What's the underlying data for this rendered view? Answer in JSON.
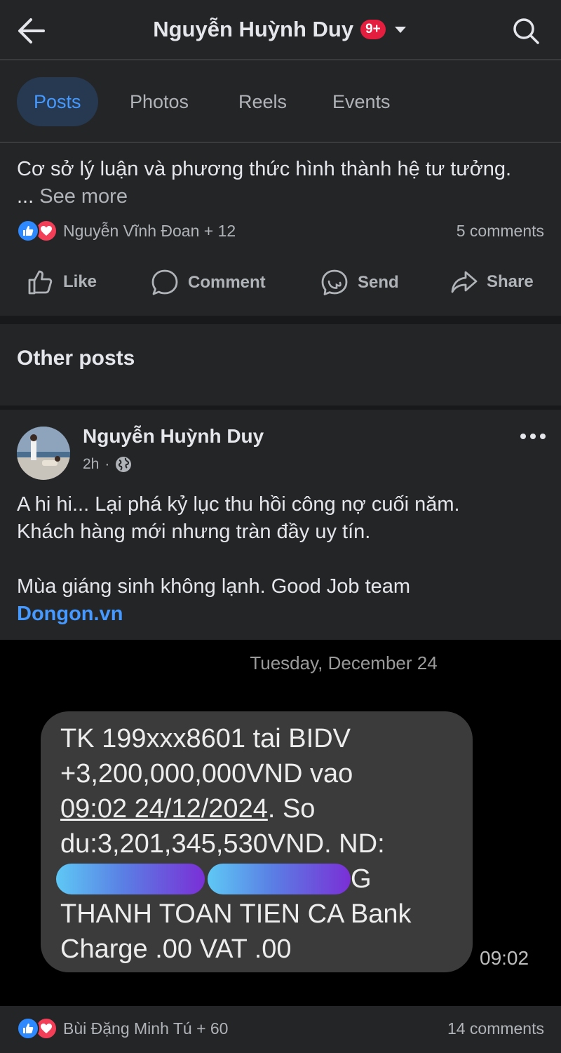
{
  "header": {
    "title": "Nguyễn Huỳnh Duy",
    "badge": "9+"
  },
  "tabs": [
    {
      "label": "Posts",
      "active": true
    },
    {
      "label": "Photos",
      "active": false
    },
    {
      "label": "Reels",
      "active": false
    },
    {
      "label": "Events",
      "active": false
    }
  ],
  "post1": {
    "text": "Cơ sở lý luận và phương thức hình thành hệ tư tưởng.",
    "see_more_prefix": "... ",
    "see_more": "See more",
    "reactions": "Nguyễn Vĩnh Đoan + 12",
    "comments": "5 comments",
    "actions": {
      "like": "Like",
      "comment": "Comment",
      "send": "Send",
      "share": "Share"
    }
  },
  "section_title": "Other posts",
  "post2": {
    "author": "Nguyễn Huỳnh Duy",
    "time": "2h",
    "separator": "·",
    "line1": "A hi hi... Lại phá kỷ lục thu hồi công nợ cuối năm.",
    "line2": "Khách hàng mới nhưng tràn đầy uy tín.",
    "line3": "Mùa giáng sinh không lạnh. Good Job team",
    "link": "Dongon.vn",
    "image": {
      "date": "Tuesday, December 24",
      "sms_line1": "TK 199xxx8601 tai BIDV",
      "sms_line2": "+3,200,000,000VND vao",
      "sms_line3_underlined": "09:02 24/12/2024",
      "sms_line3_rest": ". So",
      "sms_line4": "du:3,201,345,530VND. ND:",
      "sms_redacted_tail": "G",
      "sms_line6": "THANH TOAN TIEN CA Bank",
      "sms_line7": "Charge .00 VAT .00",
      "time": "09:02"
    },
    "reactions": "Bùi Đặng Minh Tú + 60",
    "comments": "14 comments"
  },
  "colors": {
    "background": "#242526",
    "accent_blue": "#4599ff",
    "like_blue": "#2e89ff",
    "love_red": "#f33e58",
    "badge_red": "#e41e3f"
  },
  "icons": [
    "back-arrow-icon",
    "chevron-down-icon",
    "search-icon",
    "like-icon",
    "comment-icon",
    "messenger-icon",
    "share-icon",
    "globe-icon",
    "more-icon"
  ]
}
